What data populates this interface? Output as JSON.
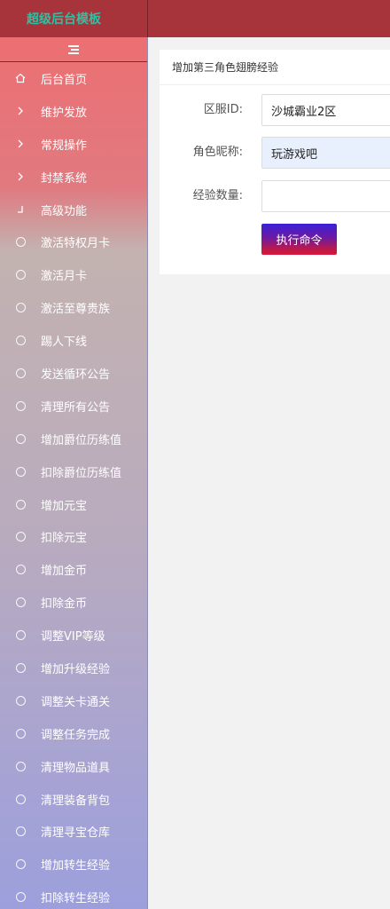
{
  "header": {
    "brand": "超级后台模板"
  },
  "sidebar": {
    "items": [
      {
        "label": "后台首页",
        "icon": "home-icon"
      },
      {
        "label": "维护发放",
        "icon": "chevron-right-icon"
      },
      {
        "label": "常规操作",
        "icon": "chevron-right-icon"
      },
      {
        "label": "封禁系统",
        "icon": "chevron-right-icon"
      },
      {
        "label": "高级功能",
        "icon": "collapse-icon"
      },
      {
        "label": "激活特权月卡",
        "icon": "circle-icon"
      },
      {
        "label": "激活月卡",
        "icon": "circle-icon"
      },
      {
        "label": "激活至尊贵族",
        "icon": "circle-icon"
      },
      {
        "label": "踢人下线",
        "icon": "circle-icon"
      },
      {
        "label": "发送循环公告",
        "icon": "circle-icon"
      },
      {
        "label": "清理所有公告",
        "icon": "circle-icon"
      },
      {
        "label": "增加爵位历练值",
        "icon": "circle-icon"
      },
      {
        "label": "扣除爵位历练值",
        "icon": "circle-icon"
      },
      {
        "label": "增加元宝",
        "icon": "circle-icon"
      },
      {
        "label": "扣除元宝",
        "icon": "circle-icon"
      },
      {
        "label": "增加金币",
        "icon": "circle-icon"
      },
      {
        "label": "扣除金币",
        "icon": "circle-icon"
      },
      {
        "label": "调整VIP等级",
        "icon": "circle-icon"
      },
      {
        "label": "增加升级经验",
        "icon": "circle-icon"
      },
      {
        "label": "调整关卡通关",
        "icon": "circle-icon"
      },
      {
        "label": "调整任务完成",
        "icon": "circle-icon"
      },
      {
        "label": "清理物品道具",
        "icon": "circle-icon"
      },
      {
        "label": "清理装备背包",
        "icon": "circle-icon"
      },
      {
        "label": "清理寻宝仓库",
        "icon": "circle-icon"
      },
      {
        "label": "增加转生经验",
        "icon": "circle-icon"
      },
      {
        "label": "扣除转生经验",
        "icon": "circle-icon"
      }
    ]
  },
  "form": {
    "title": "增加第三角色翅膀经验",
    "server_label": "区服ID:",
    "server_value": "沙城霸业2区",
    "nickname_label": "角色昵称:",
    "nickname_value": "玩游戏吧",
    "exp_label": "经验数量:",
    "exp_value": "",
    "submit_label": "执行命令"
  },
  "colors": {
    "topbar": "#a8343b",
    "brand_text": "#2fbfa3",
    "button_top": "#3b1fd6",
    "button_bottom": "#d8173a",
    "autofill_bg": "#e8f0fe"
  }
}
